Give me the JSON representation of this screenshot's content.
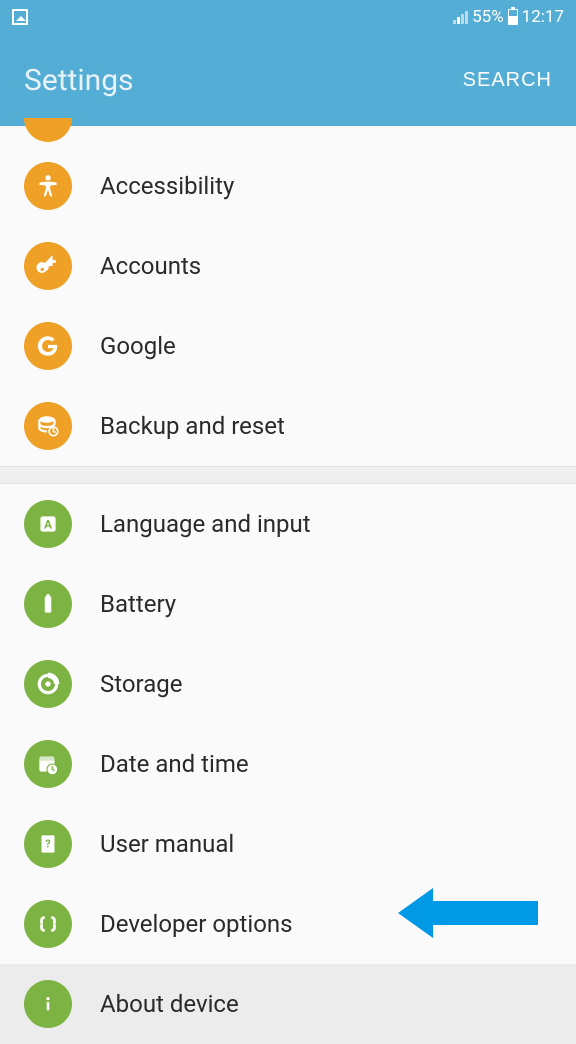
{
  "status": {
    "battery_pct": "55%",
    "time": "12:17"
  },
  "header": {
    "title": "Settings",
    "search_label": "SEARCH"
  },
  "section1": [
    {
      "label": "Accessibility"
    },
    {
      "label": "Accounts"
    },
    {
      "label": "Google"
    },
    {
      "label": "Backup and reset"
    }
  ],
  "section2": [
    {
      "label": "Language and input"
    },
    {
      "label": "Battery"
    },
    {
      "label": "Storage"
    },
    {
      "label": "Date and time"
    },
    {
      "label": "User manual"
    },
    {
      "label": "Developer options"
    },
    {
      "label": "About device"
    }
  ]
}
